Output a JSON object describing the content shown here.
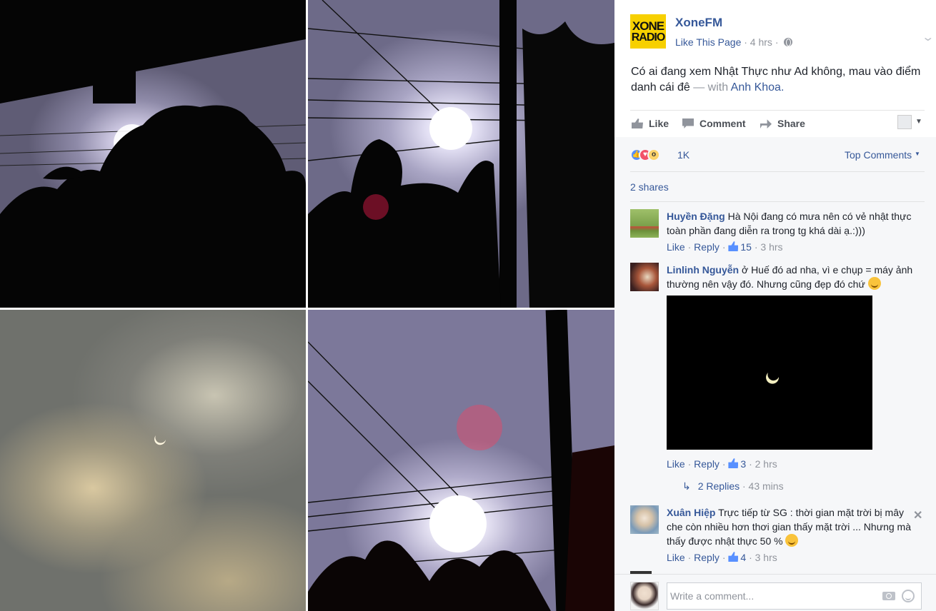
{
  "post": {
    "page_name": "XoneFM",
    "logo_line1": "XONE",
    "logo_line2": "RADIO",
    "like_page": "Like This Page",
    "time": "· 4 hrs ·",
    "text": "Có ai đang xem Nhật Thực như Ad không, mau vào điểm danh cái đê",
    "with_label": "— with",
    "tagged": "Anh Khoa",
    "tag_suffix": "."
  },
  "actions": {
    "like": "Like",
    "comment": "Comment",
    "share": "Share"
  },
  "reactions": {
    "count": "1K",
    "sort": "Top Comments",
    "shares": "2 shares"
  },
  "comments": [
    {
      "name": "Huyền Đặng",
      "text": "Hà Nội đang có mưa nên có vẻ nhật thực toàn phần đang diễn ra trong tg khá dài ạ.:)))",
      "like": "Like",
      "reply": "Reply",
      "likes": "15",
      "time": "· 3 hrs"
    },
    {
      "name": "Linlinh Nguyễn",
      "text": "ở Huế đó ad nha, vì e chụp = máy ảnh thường nên vậy đó. Nhưng cũng đẹp đó chứ",
      "like": "Like",
      "reply": "Reply",
      "likes": "3",
      "time": "· 2 hrs",
      "replies": "2 Replies",
      "replies_time": "· 43 mins"
    },
    {
      "name": "Xuân Hiệp",
      "text": "Trực tiếp từ SG : thời gian mặt trời bị mây che còn nhiều hơn thơi gian thấy mặt trời ... Nhưng mà thấy được nhật thực 50 %",
      "like": "Like",
      "reply": "Reply",
      "likes": "4",
      "time": "· 3 hrs"
    }
  ],
  "composer": {
    "placeholder": "Write a comment..."
  },
  "icons": [
    "globe-icon",
    "chevron-down-icon",
    "like-icon",
    "comment-icon",
    "share-icon",
    "camera-icon",
    "emoji-icon",
    "close-icon",
    "reply-arrow-icon"
  ],
  "colors": {
    "link": "#365899",
    "muted": "#90949c",
    "feedback_bg": "#f6f7f9",
    "logo_yellow": "#f7d000"
  }
}
